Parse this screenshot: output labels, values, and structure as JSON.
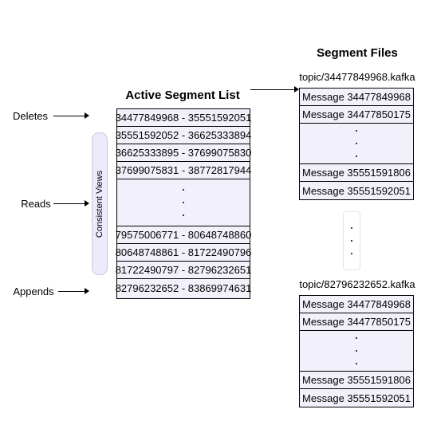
{
  "diagram": {
    "title_active_segment_list": "Active Segment List",
    "title_segment_files": "Segment Files"
  },
  "left_labels": [
    {
      "name": "deletes",
      "text": "Deletes"
    },
    {
      "name": "reads",
      "text": "Reads"
    },
    {
      "name": "appends",
      "text": "Appends"
    }
  ],
  "consistent_views": {
    "label": "Consistent Views"
  },
  "active_segment_list": {
    "header": "Active Segment List",
    "top_rows": [
      "34477849968 - 35551592051",
      "35551592052 - 36625333894",
      "36625333895 - 37699075830",
      "37699075831 - 38772817944"
    ],
    "ellipsis": "⋮",
    "bottom_rows": [
      "79575006771 - 80648748860",
      "80648748861 - 81722490796",
      "81722490797 - 82796232651",
      "82796232652 - 83869974631"
    ]
  },
  "segment_files": {
    "header": "Segment Files",
    "files": [
      {
        "name": "segment-file-first",
        "filename": "topic/34477849968.kafka",
        "top_rows": [
          "Message 34477849968",
          "Message 34477850175"
        ],
        "ellipsis": "⋮",
        "bottom_rows": [
          "Message 35551591806",
          "Message 35551592051"
        ]
      },
      {
        "name": "segment-file-last",
        "filename": "topic/82796232652.kafka",
        "top_rows": [
          "Message 34477849968",
          "Message 34477850175"
        ],
        "ellipsis": "⋮",
        "bottom_rows": [
          "Message 35551591806",
          "Message 35551592051"
        ]
      }
    ],
    "connector_ellipsis": "⋮"
  },
  "colors": {
    "row_fill": "#f2f1fb",
    "bar_fill": "#edebfa",
    "border": "#000000",
    "background": "#ffffff"
  }
}
